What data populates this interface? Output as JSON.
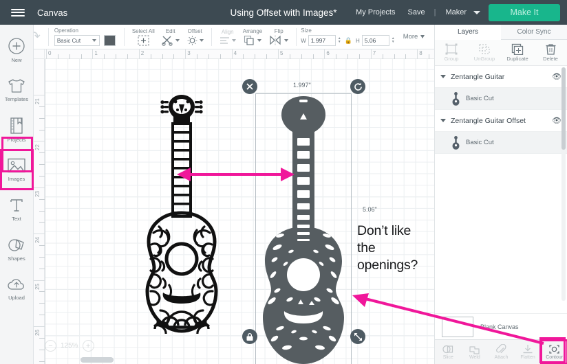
{
  "header": {
    "menu_icon": "hamburger-icon",
    "canvas_label": "Canvas",
    "title": "Using Offset with Images*",
    "my_projects": "My Projects",
    "save": "Save",
    "separator": "|",
    "machine": "Maker",
    "make_it": "Make It",
    "bg_color": "#3d4a52",
    "accent_color": "#18b68c"
  },
  "toolbar": {
    "undo_icon": "undo-arrow-icon",
    "redo_icon": "redo-arrow-icon",
    "operation_label": "Operation",
    "operation_value": "Basic Cut",
    "operation_color": "#575f64",
    "select_all": "Select All",
    "edit": "Edit",
    "offset": "Offset",
    "align": "Align",
    "arrange": "Arrange",
    "flip": "Flip",
    "size_label": "Size",
    "width_axis": "W",
    "width_value": "1.997",
    "height_axis": "H",
    "height_value": "5.06",
    "lock_icon": "lock-icon",
    "more": "More"
  },
  "sidebar": {
    "items": [
      {
        "label": "New",
        "icon": "plus-circle-icon",
        "selected": false
      },
      {
        "label": "Templates",
        "icon": "tshirt-icon",
        "selected": false
      },
      {
        "label": "Projects",
        "icon": "book-icon",
        "selected": false
      },
      {
        "label": "Images",
        "icon": "image-icon",
        "selected": true
      },
      {
        "label": "Text",
        "icon": "text-t-icon",
        "selected": false
      },
      {
        "label": "Shapes",
        "icon": "shapes-icon",
        "selected": false
      },
      {
        "label": "Upload",
        "icon": "upload-cloud-icon",
        "selected": false
      }
    ],
    "highlight_color": "#f0179a"
  },
  "canvas": {
    "ruler_h_labels": [
      "0",
      "1",
      "2",
      "3",
      "4",
      "5",
      "6",
      "7",
      "8"
    ],
    "ruler_v_labels": [
      "21",
      "22",
      "23",
      "24",
      "25",
      "26"
    ],
    "selection": {
      "width_dim": "1.997\"",
      "height_dim": "5.06\"",
      "close_icon": "close-x-icon",
      "rotate_icon": "rotate-icon",
      "lock_icon": "lock-closed-icon",
      "resize_icon": "resize-diagonal-icon"
    },
    "annotation_line1": "Don’t like",
    "annotation_line2": "the openings?",
    "zoom_minus": "−",
    "zoom_value": "125%",
    "zoom_plus": "+",
    "arrow_color": "#f0179a",
    "artwork_black": "#111111",
    "artwork_gray": "#565d61"
  },
  "right_panel": {
    "tabs": [
      {
        "label": "Layers",
        "active": true
      },
      {
        "label": "Color Sync",
        "active": false
      }
    ],
    "tools": [
      {
        "label": "Group",
        "icon": "group-icon",
        "enabled": false
      },
      {
        "label": "UnGroup",
        "icon": "ungroup-icon",
        "enabled": false
      },
      {
        "label": "Duplicate",
        "icon": "duplicate-icon",
        "enabled": true
      },
      {
        "label": "Delete",
        "icon": "trash-icon",
        "enabled": true
      }
    ],
    "layers": [
      {
        "name": "Zentangle Guitar",
        "child": "Basic Cut",
        "visibility_icon": "eye-icon"
      },
      {
        "name": "Zentangle Guitar Offset",
        "child": "Basic Cut",
        "visibility_icon": "eye-icon"
      }
    ],
    "blank_canvas_label": "Blank Canvas",
    "bottom_tools": [
      {
        "label": "Slice",
        "icon": "slice-icon",
        "enabled": false,
        "selected": false
      },
      {
        "label": "Weld",
        "icon": "weld-icon",
        "enabled": false,
        "selected": false
      },
      {
        "label": "Attach",
        "icon": "attach-paperclip-icon",
        "enabled": false,
        "selected": false
      },
      {
        "label": "Flatten",
        "icon": "flatten-icon",
        "enabled": false,
        "selected": false
      },
      {
        "label": "Contour",
        "icon": "contour-icon",
        "enabled": true,
        "selected": true
      }
    ]
  }
}
